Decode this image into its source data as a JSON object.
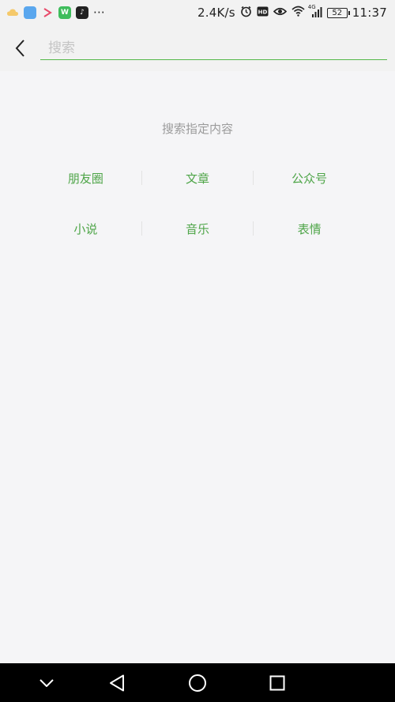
{
  "status_bar": {
    "network_speed": "2.4K/s",
    "signal_label": "4G",
    "battery_level": "52",
    "time": "11:37",
    "more_indicator": "···",
    "notification_icons": [
      "cloud-icon",
      "blue-app-icon",
      "arrow-app-icon",
      "wechat-work-icon",
      "tiktok-icon"
    ],
    "status_icons": [
      "alarm-icon",
      "hd-icon",
      "eye-icon",
      "wifi-icon",
      "signal-icon",
      "battery-icon"
    ]
  },
  "search": {
    "placeholder": "搜索",
    "value": "",
    "accent_color": "#55b84a"
  },
  "hint": "搜索指定内容",
  "categories": [
    [
      "朋友圈",
      "文章",
      "公众号"
    ],
    [
      "小说",
      "音乐",
      "表情"
    ]
  ],
  "nav": {
    "icons": [
      "chevron-down-icon",
      "back-triangle-icon",
      "home-circle-icon",
      "recents-square-icon"
    ]
  }
}
